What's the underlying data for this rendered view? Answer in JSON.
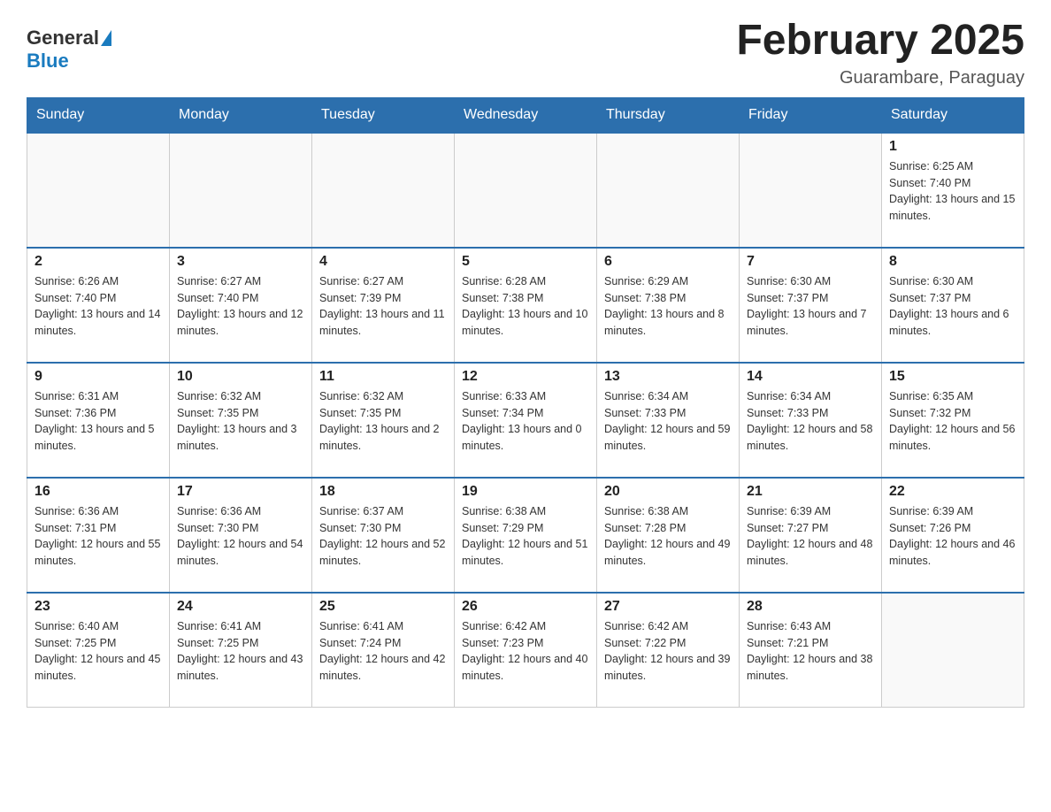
{
  "header": {
    "logo": {
      "general": "General",
      "blue": "Blue"
    },
    "title": "February 2025",
    "location": "Guarambare, Paraguay"
  },
  "days_of_week": [
    "Sunday",
    "Monday",
    "Tuesday",
    "Wednesday",
    "Thursday",
    "Friday",
    "Saturday"
  ],
  "weeks": [
    [
      {
        "day": "",
        "info": ""
      },
      {
        "day": "",
        "info": ""
      },
      {
        "day": "",
        "info": ""
      },
      {
        "day": "",
        "info": ""
      },
      {
        "day": "",
        "info": ""
      },
      {
        "day": "",
        "info": ""
      },
      {
        "day": "1",
        "info": "Sunrise: 6:25 AM\nSunset: 7:40 PM\nDaylight: 13 hours and 15 minutes."
      }
    ],
    [
      {
        "day": "2",
        "info": "Sunrise: 6:26 AM\nSunset: 7:40 PM\nDaylight: 13 hours and 14 minutes."
      },
      {
        "day": "3",
        "info": "Sunrise: 6:27 AM\nSunset: 7:40 PM\nDaylight: 13 hours and 12 minutes."
      },
      {
        "day": "4",
        "info": "Sunrise: 6:27 AM\nSunset: 7:39 PM\nDaylight: 13 hours and 11 minutes."
      },
      {
        "day": "5",
        "info": "Sunrise: 6:28 AM\nSunset: 7:38 PM\nDaylight: 13 hours and 10 minutes."
      },
      {
        "day": "6",
        "info": "Sunrise: 6:29 AM\nSunset: 7:38 PM\nDaylight: 13 hours and 8 minutes."
      },
      {
        "day": "7",
        "info": "Sunrise: 6:30 AM\nSunset: 7:37 PM\nDaylight: 13 hours and 7 minutes."
      },
      {
        "day": "8",
        "info": "Sunrise: 6:30 AM\nSunset: 7:37 PM\nDaylight: 13 hours and 6 minutes."
      }
    ],
    [
      {
        "day": "9",
        "info": "Sunrise: 6:31 AM\nSunset: 7:36 PM\nDaylight: 13 hours and 5 minutes."
      },
      {
        "day": "10",
        "info": "Sunrise: 6:32 AM\nSunset: 7:35 PM\nDaylight: 13 hours and 3 minutes."
      },
      {
        "day": "11",
        "info": "Sunrise: 6:32 AM\nSunset: 7:35 PM\nDaylight: 13 hours and 2 minutes."
      },
      {
        "day": "12",
        "info": "Sunrise: 6:33 AM\nSunset: 7:34 PM\nDaylight: 13 hours and 0 minutes."
      },
      {
        "day": "13",
        "info": "Sunrise: 6:34 AM\nSunset: 7:33 PM\nDaylight: 12 hours and 59 minutes."
      },
      {
        "day": "14",
        "info": "Sunrise: 6:34 AM\nSunset: 7:33 PM\nDaylight: 12 hours and 58 minutes."
      },
      {
        "day": "15",
        "info": "Sunrise: 6:35 AM\nSunset: 7:32 PM\nDaylight: 12 hours and 56 minutes."
      }
    ],
    [
      {
        "day": "16",
        "info": "Sunrise: 6:36 AM\nSunset: 7:31 PM\nDaylight: 12 hours and 55 minutes."
      },
      {
        "day": "17",
        "info": "Sunrise: 6:36 AM\nSunset: 7:30 PM\nDaylight: 12 hours and 54 minutes."
      },
      {
        "day": "18",
        "info": "Sunrise: 6:37 AM\nSunset: 7:30 PM\nDaylight: 12 hours and 52 minutes."
      },
      {
        "day": "19",
        "info": "Sunrise: 6:38 AM\nSunset: 7:29 PM\nDaylight: 12 hours and 51 minutes."
      },
      {
        "day": "20",
        "info": "Sunrise: 6:38 AM\nSunset: 7:28 PM\nDaylight: 12 hours and 49 minutes."
      },
      {
        "day": "21",
        "info": "Sunrise: 6:39 AM\nSunset: 7:27 PM\nDaylight: 12 hours and 48 minutes."
      },
      {
        "day": "22",
        "info": "Sunrise: 6:39 AM\nSunset: 7:26 PM\nDaylight: 12 hours and 46 minutes."
      }
    ],
    [
      {
        "day": "23",
        "info": "Sunrise: 6:40 AM\nSunset: 7:25 PM\nDaylight: 12 hours and 45 minutes."
      },
      {
        "day": "24",
        "info": "Sunrise: 6:41 AM\nSunset: 7:25 PM\nDaylight: 12 hours and 43 minutes."
      },
      {
        "day": "25",
        "info": "Sunrise: 6:41 AM\nSunset: 7:24 PM\nDaylight: 12 hours and 42 minutes."
      },
      {
        "day": "26",
        "info": "Sunrise: 6:42 AM\nSunset: 7:23 PM\nDaylight: 12 hours and 40 minutes."
      },
      {
        "day": "27",
        "info": "Sunrise: 6:42 AM\nSunset: 7:22 PM\nDaylight: 12 hours and 39 minutes."
      },
      {
        "day": "28",
        "info": "Sunrise: 6:43 AM\nSunset: 7:21 PM\nDaylight: 12 hours and 38 minutes."
      },
      {
        "day": "",
        "info": ""
      }
    ]
  ]
}
